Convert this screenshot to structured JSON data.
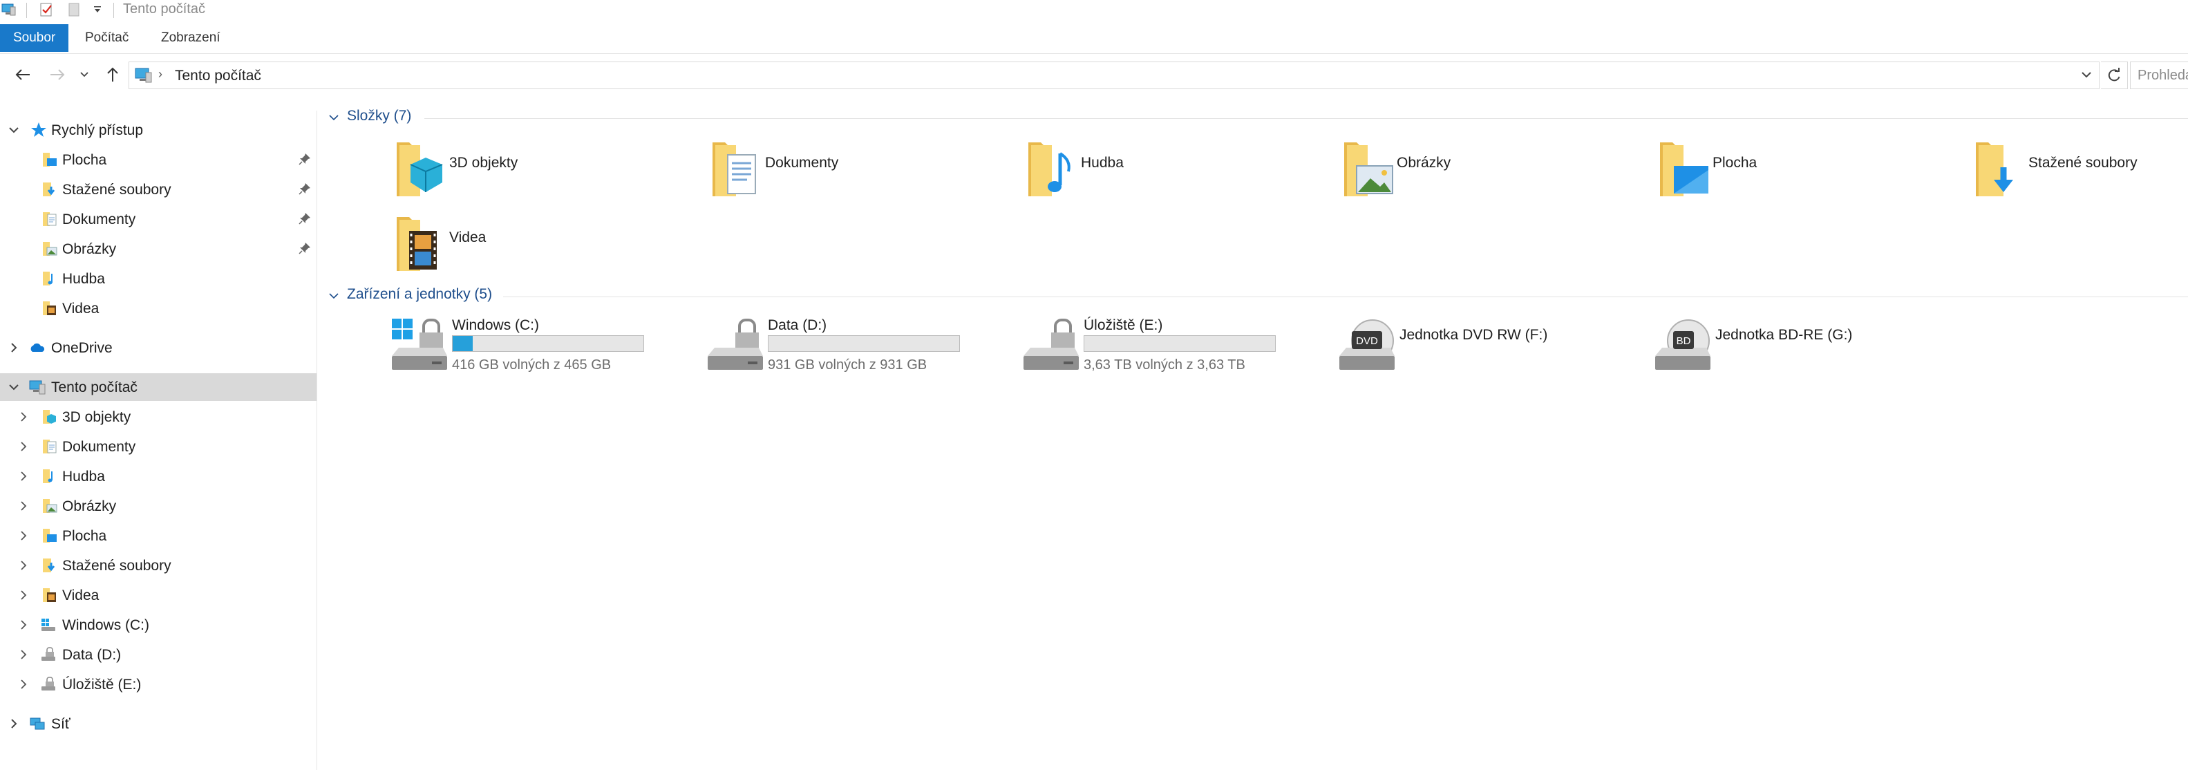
{
  "window": {
    "title": "Tento počítač"
  },
  "ribbon": {
    "tabs": [
      "Soubor",
      "Počítač",
      "Zobrazení"
    ]
  },
  "address": {
    "location": "Tento počítač",
    "search_placeholder": "Prohledat: Tento počítač"
  },
  "nav": {
    "quick_access": {
      "label": "Rychlý přístup",
      "items": [
        {
          "label": "Plocha",
          "icon": "desktop-folder-icon",
          "pinned": true
        },
        {
          "label": "Stažené soubory",
          "icon": "downloads-folder-icon",
          "pinned": true
        },
        {
          "label": "Dokumenty",
          "icon": "documents-folder-icon",
          "pinned": true
        },
        {
          "label": "Obrázky",
          "icon": "pictures-folder-icon",
          "pinned": true
        },
        {
          "label": "Hudba",
          "icon": "music-folder-icon",
          "pinned": false
        },
        {
          "label": "Videa",
          "icon": "videos-folder-icon",
          "pinned": false
        }
      ]
    },
    "onedrive": {
      "label": "OneDrive"
    },
    "this_pc": {
      "label": "Tento počítač",
      "items": [
        {
          "label": "3D objekty",
          "icon": "3d-objects-folder-icon"
        },
        {
          "label": "Dokumenty",
          "icon": "documents-folder-icon"
        },
        {
          "label": "Hudba",
          "icon": "music-folder-icon"
        },
        {
          "label": "Obrázky",
          "icon": "pictures-folder-icon"
        },
        {
          "label": "Plocha",
          "icon": "desktop-folder-icon"
        },
        {
          "label": "Stažené soubory",
          "icon": "downloads-folder-icon"
        },
        {
          "label": "Videa",
          "icon": "videos-folder-icon"
        },
        {
          "label": "Windows (C:)",
          "icon": "windows-drive-icon"
        },
        {
          "label": "Data (D:)",
          "icon": "drive-icon"
        },
        {
          "label": "Úložiště (E:)",
          "icon": "drive-icon"
        }
      ]
    },
    "network": {
      "label": "Síť"
    }
  },
  "content": {
    "folders_group": {
      "title": "Složky (7)",
      "items": [
        {
          "name": "3D objekty",
          "icon": "3d-objects-folder-icon"
        },
        {
          "name": "Dokumenty",
          "icon": "documents-folder-icon"
        },
        {
          "name": "Hudba",
          "icon": "music-folder-icon"
        },
        {
          "name": "Obrázky",
          "icon": "pictures-folder-icon"
        },
        {
          "name": "Plocha",
          "icon": "desktop-folder-icon"
        },
        {
          "name": "Stažené soubory",
          "icon": "downloads-folder-icon"
        },
        {
          "name": "Videa",
          "icon": "videos-folder-icon"
        }
      ]
    },
    "drives_group": {
      "title": "Zařízení a jednotky (5)",
      "items": [
        {
          "name": "Windows (C:)",
          "free": "416 GB volných z 465 GB",
          "used_fraction": 0.105,
          "icon": "windows-drive-icon"
        },
        {
          "name": "Data (D:)",
          "free": "931 GB volných z 931 GB",
          "used_fraction": 0.0,
          "icon": "drive-icon"
        },
        {
          "name": "Úložiště (E:)",
          "free": "3,63 TB volných z 3,63 TB",
          "used_fraction": 0.0,
          "icon": "drive-icon"
        },
        {
          "name": "Jednotka DVD RW (F:)",
          "icon": "dvd-drive-icon",
          "badge": "DVD"
        },
        {
          "name": "Jednotka BD-RE (G:)",
          "icon": "bd-drive-icon",
          "badge": "BD"
        }
      ]
    }
  },
  "colors": {
    "accent": "#1979ca",
    "usage_bar": "#26a0da",
    "selection": "#d9d9d9",
    "group_header": "#1e4e8c",
    "folder": "#f8d775"
  }
}
